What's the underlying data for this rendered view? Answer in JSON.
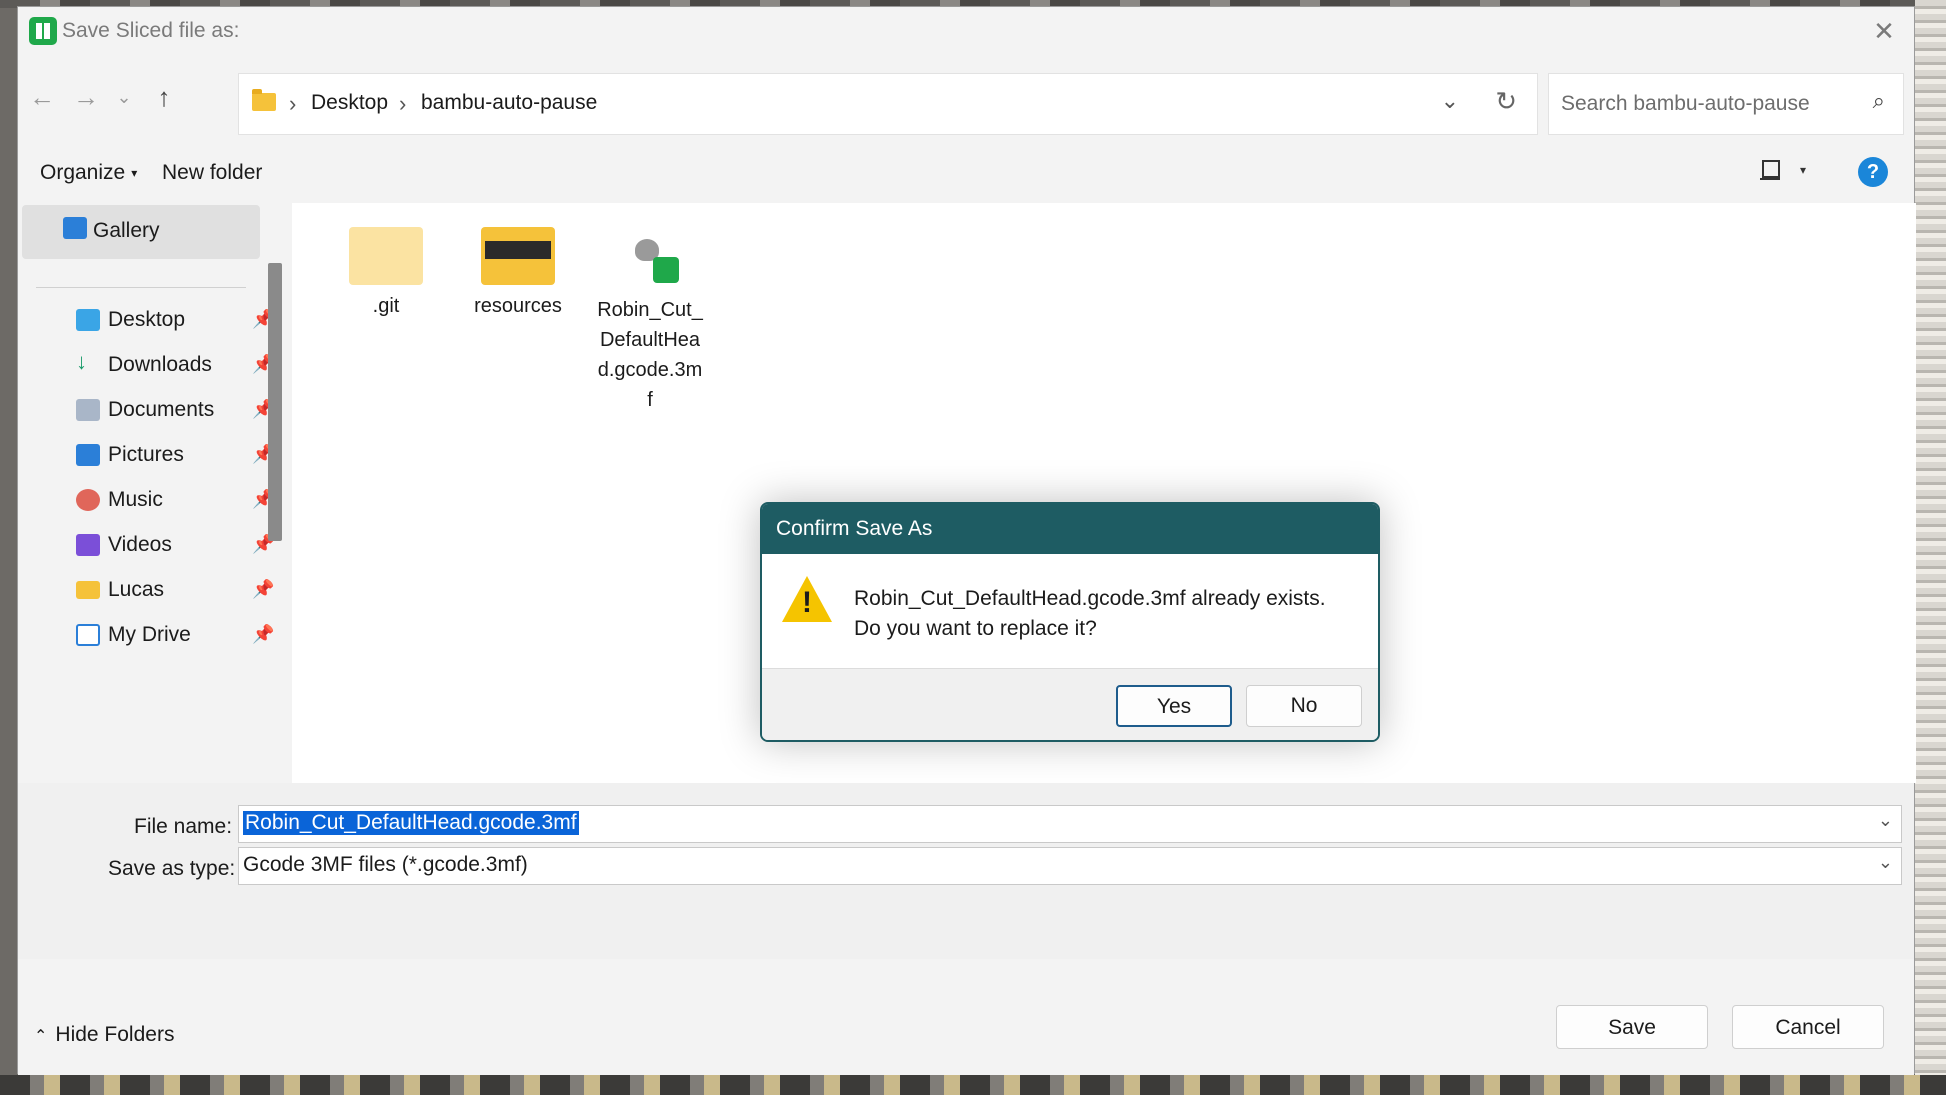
{
  "window": {
    "title": "Save Sliced file as:"
  },
  "breadcrumb": {
    "items": [
      "Desktop",
      "bambu-auto-pause"
    ]
  },
  "search": {
    "placeholder": "Search bambu-auto-pause"
  },
  "toolbar": {
    "organize_label": "Organize",
    "new_folder_label": "New folder"
  },
  "sidebar": {
    "gallery_label": "Gallery",
    "items": [
      {
        "label": "Desktop",
        "icon": "desktop-icon"
      },
      {
        "label": "Downloads",
        "icon": "download-icon"
      },
      {
        "label": "Documents",
        "icon": "documents-icon"
      },
      {
        "label": "Pictures",
        "icon": "pictures-icon"
      },
      {
        "label": "Music",
        "icon": "music-icon"
      },
      {
        "label": "Videos",
        "icon": "videos-icon"
      },
      {
        "label": "Lucas",
        "icon": "folder-icon"
      },
      {
        "label": "My Drive",
        "icon": "drive-icon"
      }
    ]
  },
  "files": [
    {
      "name": ".git",
      "type": "folder"
    },
    {
      "name": "resources",
      "type": "folder"
    },
    {
      "name": "Robin_Cut_DefaultHead.gcode.3mf",
      "type": "3mf"
    }
  ],
  "form": {
    "file_name_label": "File name:",
    "file_name_value": "Robin_Cut_DefaultHead.gcode.3mf",
    "save_type_label": "Save as type:",
    "save_type_value": "Gcode 3MF files (*.gcode.3mf)"
  },
  "footer": {
    "hide_folders_label": "Hide Folders",
    "save_label": "Save",
    "cancel_label": "Cancel"
  },
  "confirm": {
    "title": "Confirm Save As",
    "line1": "Robin_Cut_DefaultHead.gcode.3mf already exists.",
    "line2": "Do you want to replace it?",
    "yes_label": "Yes",
    "no_label": "No"
  },
  "colors": {
    "accent": "#1a86d9",
    "confirm_header": "#1e5c63",
    "selection": "#0a64d8",
    "app_icon": "#1fa84a"
  }
}
